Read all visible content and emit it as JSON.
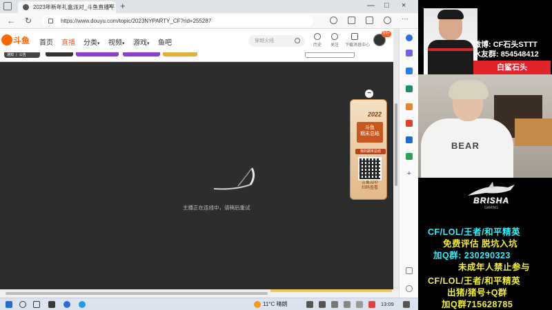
{
  "browser": {
    "tab_title": "2023年新年礼盒派对_斗鱼直播平",
    "tab_close": "×",
    "new_tab": "+",
    "win_min": "—",
    "win_max": "□",
    "win_close": "×",
    "url": "https://www.douyu.com/topic/2023NYPARTY_CF?rid=255287",
    "back": "←",
    "refresh": "↻"
  },
  "site": {
    "logo_text": "斗鱼",
    "nav": [
      "首页",
      "直播",
      "分类",
      "视频",
      "游戏",
      "鱼吧"
    ],
    "nav_arrows": [
      "",
      "",
      "▾",
      "▾",
      "▾",
      ""
    ],
    "active_nav_index": 1,
    "search_placeholder": "穿越火线",
    "tools": [
      {
        "label": "历史",
        "icon": "history-icon"
      },
      {
        "label": "关注",
        "icon": "heart-icon"
      },
      {
        "label": "下载",
        "icon": "download-icon"
      },
      {
        "label": "消息中心",
        "icon": "message-icon"
      }
    ],
    "avatar_badge": "99+",
    "notice_tag": "通知 丨 公告"
  },
  "player": {
    "status_text": "主播正在连线中，请稍后重试",
    "promo": {
      "close": "−",
      "year": "2022",
      "title_line1": "斗鱼",
      "title_line2": "期末总结",
      "hint": "我的期末总结",
      "app_line1": "斗鱼APP",
      "app_line2": "扫码查看"
    }
  },
  "taskbar": {
    "weather": "11°C 晴朗",
    "time": "13:09"
  },
  "overlay": {
    "weibo": "微博: CF石头STTT",
    "fans": "水友群: 854548412",
    "nameplate": "白鲨石头",
    "hoodie_text": "BEAR",
    "brand_name": "BRISHA",
    "brand_sub": "GAMING",
    "ad_lines": [
      {
        "text": "CF/LOL/王者/和平精英",
        "color": "#2ff0ff"
      },
      {
        "text": "免费评估  脱坑入坑",
        "color": "#f2ef32"
      },
      {
        "text": "加Q群: 230290323",
        "color": "#2ff0ff"
      },
      {
        "text": "未成年人禁止参与",
        "color": "#f2ef32"
      },
      {
        "text": "CF/LOL/王者/和平精英",
        "color": "#f2ef32"
      },
      {
        "text": "出猪/猪号+Q群",
        "color": "#f2ef32"
      },
      {
        "text": "加Q群715628785",
        "color": "#f2ef32"
      }
    ]
  },
  "colors": {
    "douyu_orange": "#ff5d23",
    "player_bg": "#2d2d2d",
    "overlay_red": "#e0242a"
  }
}
